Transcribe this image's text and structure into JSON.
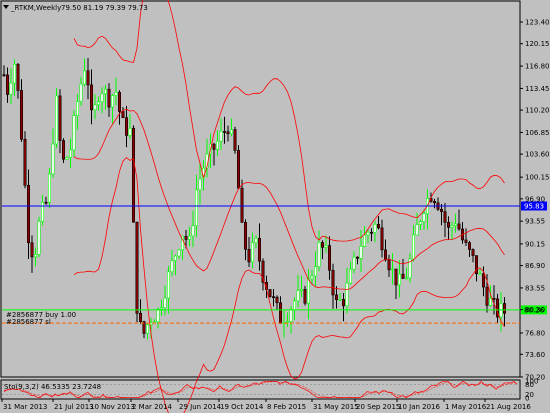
{
  "header": {
    "symbol": "_RTKM,Weekly",
    "ohlc": "79.50 81.19 79.39 79.73"
  },
  "chart_data": {
    "type": "candlestick",
    "title": "_RTKM,Weekly",
    "ylim": [
      70.2,
      125.8
    ],
    "y_ticks": [
      "123.40",
      "120.15",
      "116.80",
      "113.45",
      "110.20",
      "106.85",
      "103.60",
      "100.15",
      "96.90",
      "93.55",
      "90.15",
      "86.90",
      "83.55",
      "80.30",
      "76.80",
      "73.60",
      "70.20"
    ],
    "x_ticks": [
      "31 Mar 2013",
      "21 Jul 2013",
      "10 Nov 2013",
      "2 Mar 2014",
      "29 Jun 2014",
      "19 Oct 2014",
      "8 Feb 2015",
      "31 May 2015",
      "20 Sep 2015",
      "10 Jan 2016",
      "1 May 2016",
      "21 Aug 2016"
    ],
    "hlines": [
      {
        "label": "95.83",
        "value": 95.83,
        "color": "#0000ff"
      },
      {
        "label": "80.26",
        "value": 80.26,
        "color": "#00ff00"
      },
      {
        "label": "78.27",
        "value": 78.27,
        "color": "#ff6600"
      }
    ],
    "annotations": [
      "#2856877 buy 1.00",
      "#2856877 sl"
    ],
    "indicator": {
      "label": "Sto(9,3,2) 46.5335 23.7248",
      "ylim": [
        0,
        100
      ],
      "ticks": [
        "100",
        "80",
        "20",
        "0"
      ]
    }
  },
  "colors": {
    "background": "#c0c0c0",
    "bull": "#00ff00",
    "bear": "#000000",
    "bull_body": "#ffffff",
    "bear_body": "#8b0000",
    "bands": "#ff0000"
  }
}
